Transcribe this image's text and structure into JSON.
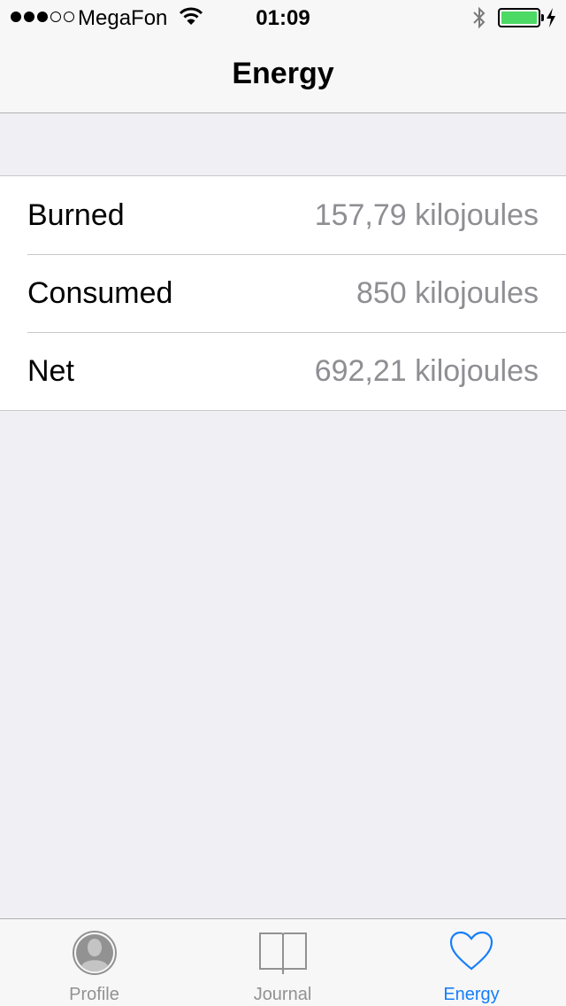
{
  "status_bar": {
    "carrier": "MegaFon",
    "time": "01:09",
    "signal_bars_filled": 3,
    "signal_bars_total": 5,
    "battery_color": "#4cd964"
  },
  "nav": {
    "title": "Energy"
  },
  "energy_rows": [
    {
      "label": "Burned",
      "value": "157,79 kilojoules"
    },
    {
      "label": "Consumed",
      "value": "850 kilojoules"
    },
    {
      "label": "Net",
      "value": "692,21 kilojoules"
    }
  ],
  "tabs": [
    {
      "label": "Profile",
      "icon": "profile-icon",
      "active": false
    },
    {
      "label": "Journal",
      "icon": "book-icon",
      "active": false
    },
    {
      "label": "Energy",
      "icon": "heart-icon",
      "active": true
    }
  ],
  "colors": {
    "accent": "#157efb",
    "inactive": "#929292",
    "background": "#efeff4"
  }
}
